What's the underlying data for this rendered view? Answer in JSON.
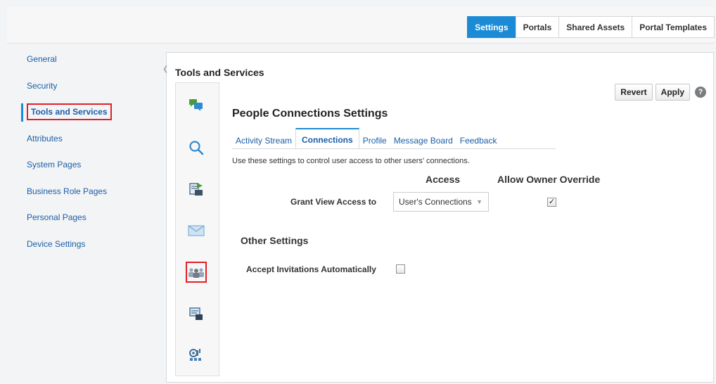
{
  "top_tabs": [
    {
      "label": "Settings",
      "active": true
    },
    {
      "label": "Portals",
      "active": false
    },
    {
      "label": "Shared Assets",
      "active": false
    },
    {
      "label": "Portal Templates",
      "active": false
    }
  ],
  "left_nav": [
    {
      "label": "General"
    },
    {
      "label": "Security"
    },
    {
      "label": "Tools and Services",
      "active": true
    },
    {
      "label": "Attributes"
    },
    {
      "label": "System Pages"
    },
    {
      "label": "Business Role Pages"
    },
    {
      "label": "Personal Pages"
    },
    {
      "label": "Device Settings"
    }
  ],
  "panel": {
    "title": "Tools and Services",
    "icons": [
      "chat-bubbles-icon",
      "search-icon",
      "document-export-icon",
      "mail-icon",
      "people-connections-icon",
      "presentation-icon",
      "services-gear-icon"
    ],
    "revert_label": "Revert",
    "apply_label": "Apply",
    "help_label": "?"
  },
  "section": {
    "title": "People Connections Settings",
    "tabs": [
      {
        "label": "Activity Stream"
      },
      {
        "label": "Connections",
        "active": true
      },
      {
        "label": "Profile"
      },
      {
        "label": "Message Board"
      },
      {
        "label": "Feedback"
      }
    ],
    "description": "Use these settings to control user access to other users' connections.",
    "col_access": "Access",
    "col_override": "Allow Owner Override",
    "grant_label": "Grant View Access to",
    "grant_value": "User's Connections",
    "grant_override_checked": true,
    "other_title": "Other Settings",
    "accept_label": "Accept Invitations Automatically",
    "accept_checked": false
  },
  "colors": {
    "accent": "#1c8bd6",
    "highlight": "#e0202a",
    "link": "#1b5ea8"
  }
}
